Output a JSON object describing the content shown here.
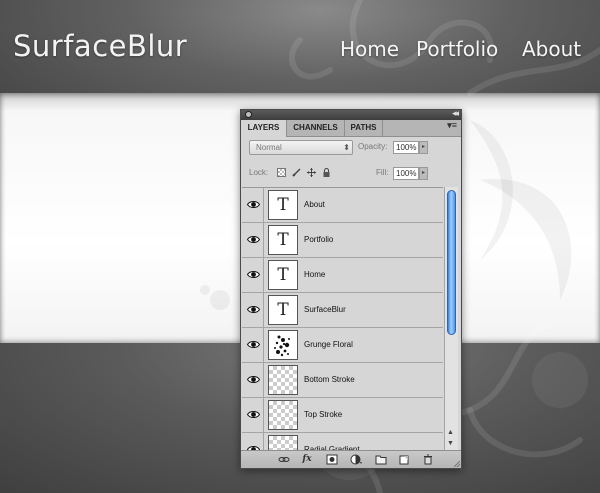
{
  "site": {
    "logo": "SurfaceBlur",
    "nav": [
      "Home",
      "Portfolio",
      "About"
    ]
  },
  "panel": {
    "tabs": [
      "LAYERS",
      "CHANNELS",
      "PATHS"
    ],
    "active_tab": "LAYERS",
    "blend_mode": "Normal",
    "opacity_label": "Opacity:",
    "opacity_value": "100%",
    "lock_label": "Lock:",
    "fill_label": "Fill:",
    "fill_value": "100%",
    "layers": [
      {
        "name": "About",
        "thumb": "text",
        "thumb_glyph": "T",
        "visible": true
      },
      {
        "name": "Portfolio",
        "thumb": "text",
        "thumb_glyph": "T",
        "visible": true
      },
      {
        "name": "Home",
        "thumb": "text",
        "thumb_glyph": "T",
        "visible": true
      },
      {
        "name": "SurfaceBlur",
        "thumb": "text",
        "thumb_glyph": "T",
        "visible": true
      },
      {
        "name": "Grunge Floral",
        "thumb": "pattern",
        "visible": true
      },
      {
        "name": "Bottom Stroke",
        "thumb": "transparent",
        "visible": true
      },
      {
        "name": "Top Stroke",
        "thumb": "transparent",
        "visible": true
      },
      {
        "name": "Radial Gradient",
        "thumb": "transparent",
        "visible": true
      }
    ],
    "bottom_icons": [
      "link-layers-icon",
      "fx-icon",
      "layer-mask-icon",
      "adjustment-layer-icon",
      "group-folder-icon",
      "new-layer-icon",
      "trash-icon"
    ],
    "colors": {
      "panel_bg": "#d6d6d6",
      "scroll_thumb": "#5aa0f0"
    }
  }
}
